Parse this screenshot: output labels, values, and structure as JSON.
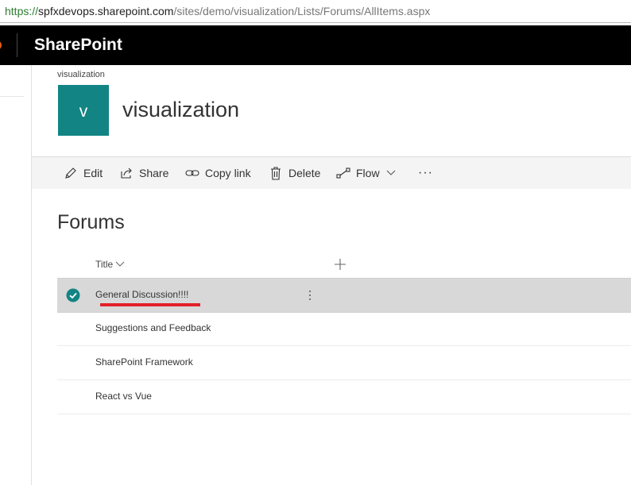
{
  "address_bar": {
    "protocol": "https://",
    "host": "spfxdevops.sharepoint.com",
    "path": "/sites/demo/visualization/Lists/Forums/AllItems.aspx"
  },
  "suite_bar": {
    "brand": "SharePoint"
  },
  "site": {
    "breadcrumb": "visualization",
    "logo_letter": "v",
    "logo_color": "#138484",
    "title": "visualization"
  },
  "command_bar": {
    "edit": "Edit",
    "share": "Share",
    "copy_link": "Copy link",
    "delete": "Delete",
    "flow": "Flow",
    "more": "···"
  },
  "list": {
    "title": "Forums",
    "column_header": "Title",
    "rows": [
      {
        "title": "General Discussion!!!!",
        "selected": true
      },
      {
        "title": "Suggestions and Feedback",
        "selected": false
      },
      {
        "title": "SharePoint Framework",
        "selected": false
      },
      {
        "title": "React vs Vue",
        "selected": false
      }
    ]
  },
  "colors": {
    "accent": "#138484",
    "highlight_underline": "#e2202a",
    "suite_bar": "#000000",
    "selected_row": "#d8d8d8"
  }
}
